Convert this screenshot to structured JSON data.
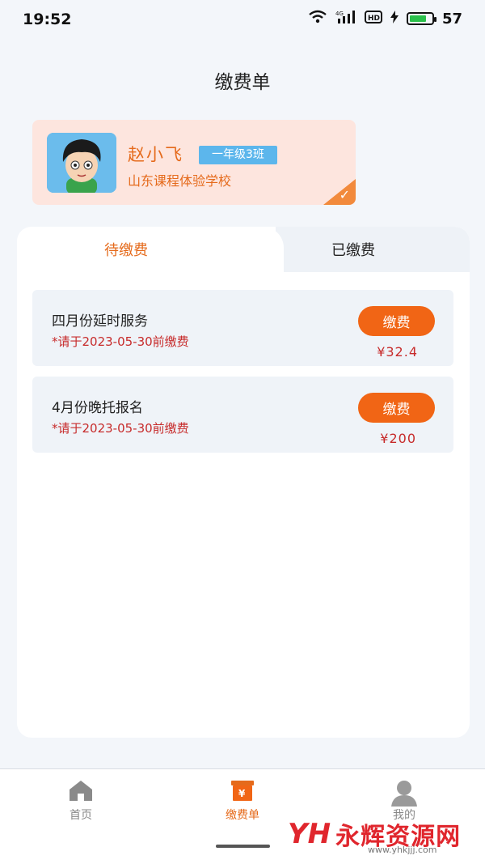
{
  "status_bar": {
    "time": "19:52",
    "battery": "57"
  },
  "header": {
    "title": "缴费单"
  },
  "student": {
    "name": "赵小飞",
    "class": "一年级3班",
    "school": "山东课程体验学校"
  },
  "tabs": [
    {
      "label": "待缴费",
      "active": true
    },
    {
      "label": "已缴费",
      "active": false
    }
  ],
  "bills": [
    {
      "title": "四月份延时服务",
      "deadline": "*请于2023-05-30前缴费",
      "pay_label": "缴费",
      "amount": "¥32.4"
    },
    {
      "title": "4月份晚托报名",
      "deadline": "*请于2023-05-30前缴费",
      "pay_label": "缴费",
      "amount": "¥200"
    }
  ],
  "bottom_nav": [
    {
      "label": "首页",
      "icon": "home-icon"
    },
    {
      "label": "缴费单",
      "icon": "bill-icon"
    },
    {
      "label": "我的",
      "icon": "user-icon"
    }
  ],
  "watermark": {
    "logo": "YH",
    "text": "永辉资源网",
    "url": "www.yhkjjj.com"
  },
  "colors": {
    "accent": "#f16515",
    "highlight": "#e56a1b",
    "danger": "#c72b2b",
    "badge": "#5cb6ec"
  }
}
